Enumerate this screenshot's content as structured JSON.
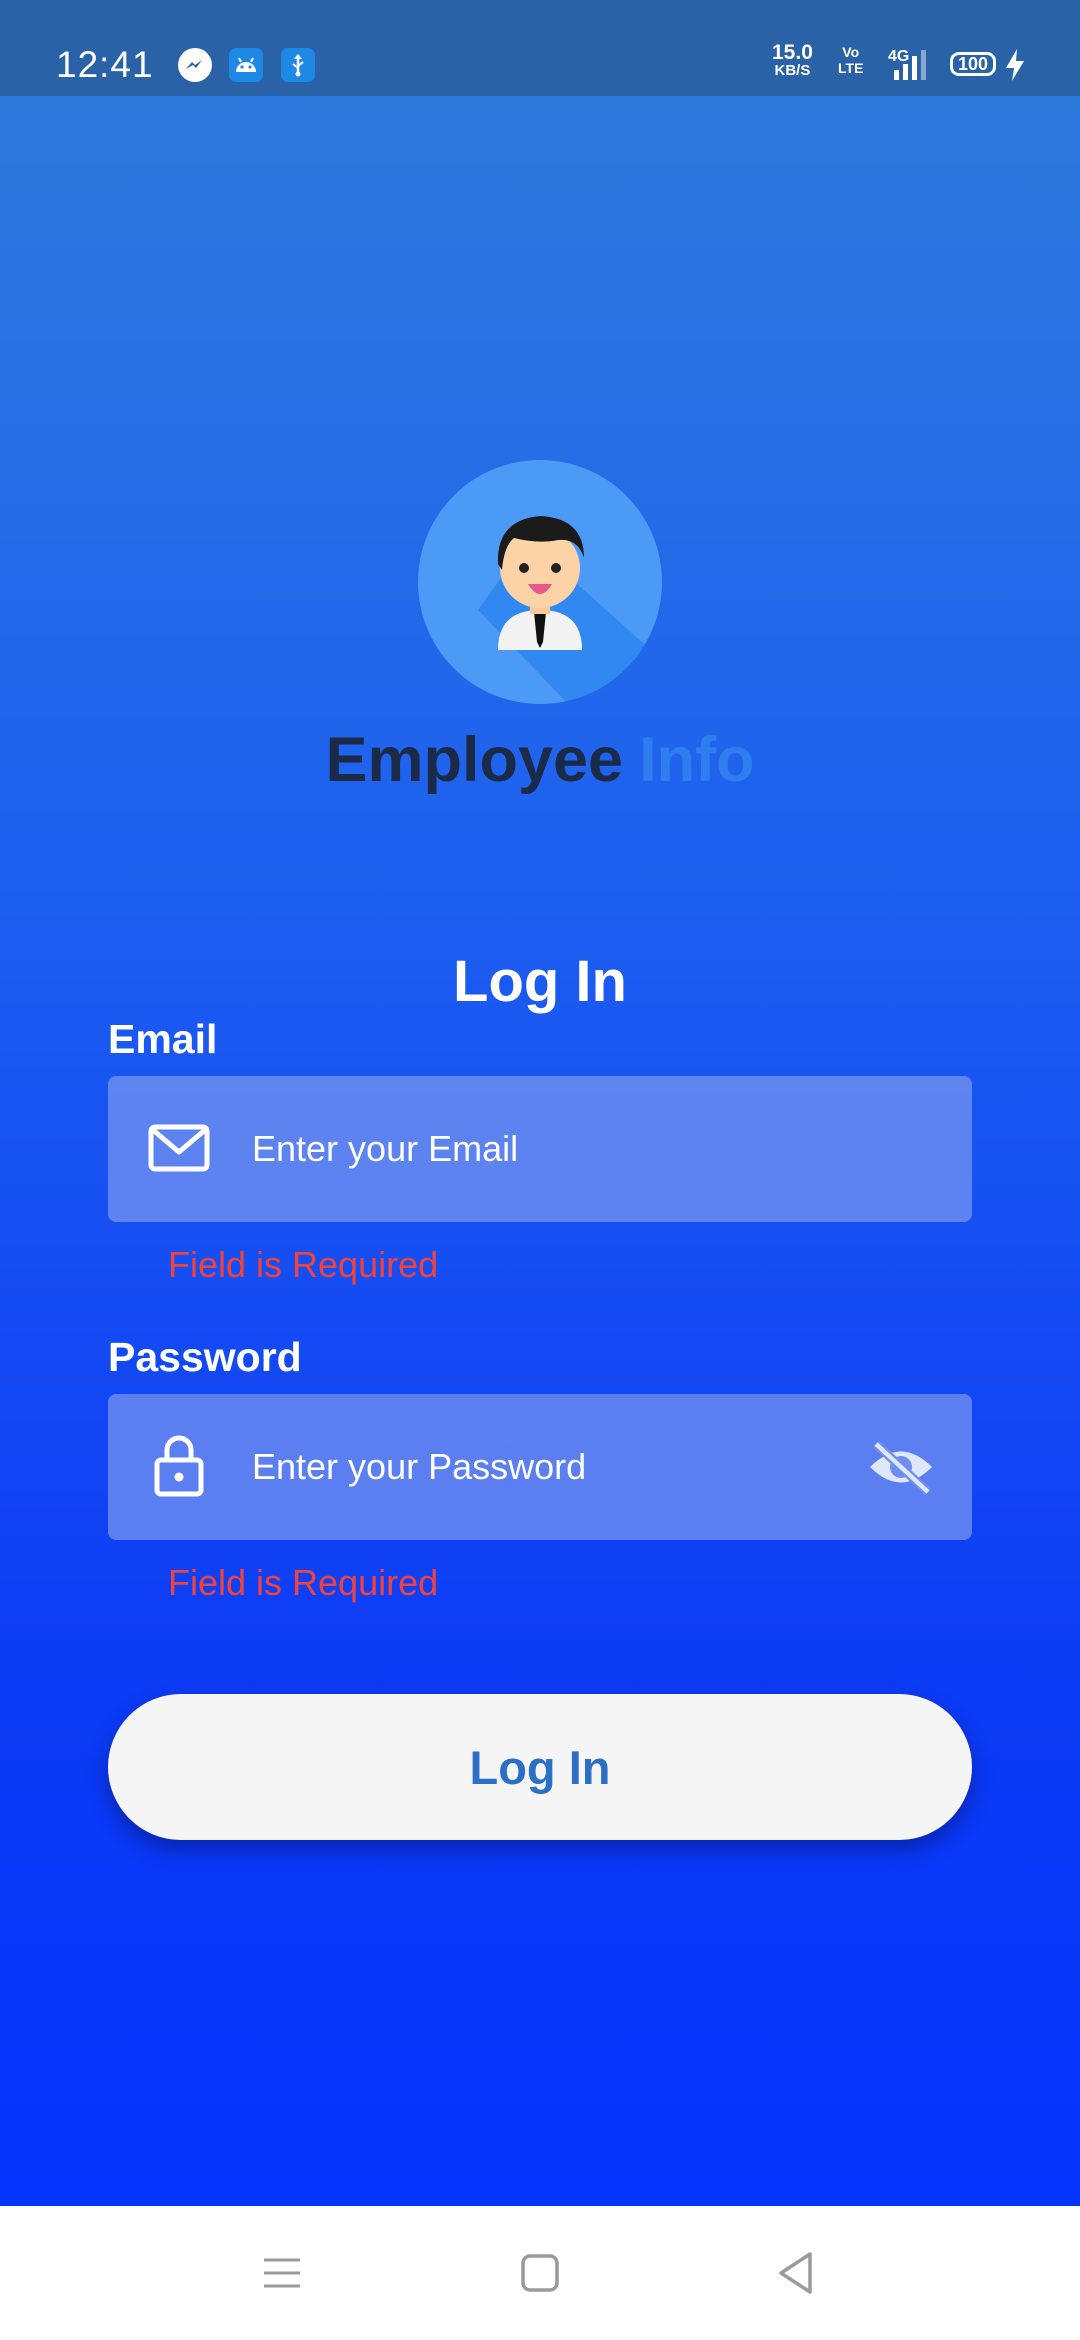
{
  "status_bar": {
    "time": "12:41",
    "net_speed_value": "15.0",
    "net_speed_unit": "KB/S",
    "volte_top": "Vo",
    "volte_bottom": "LTE",
    "network": "4G",
    "battery": "100",
    "icons": [
      "messenger-icon",
      "android-icon",
      "usb-icon",
      "signal-icon",
      "charging-icon"
    ]
  },
  "app": {
    "brand_part1": "Employee",
    "brand_part2": "Info"
  },
  "login": {
    "title": "Log In",
    "email_label": "Email",
    "email_placeholder": "Enter your Email",
    "email_error": "Field is Required",
    "password_label": "Password",
    "password_placeholder": "Enter your Password",
    "password_error": "Field is Required",
    "button_label": "Log In"
  },
  "colors": {
    "gradient_top": "#2f7ddb",
    "gradient_bottom": "#0433fd",
    "error": "#f0433f",
    "button_text": "#2b6fc6",
    "brand_accent": "#2f7ef0"
  },
  "nav": {
    "icons": [
      "menu-icon",
      "home-icon",
      "back-icon"
    ]
  }
}
